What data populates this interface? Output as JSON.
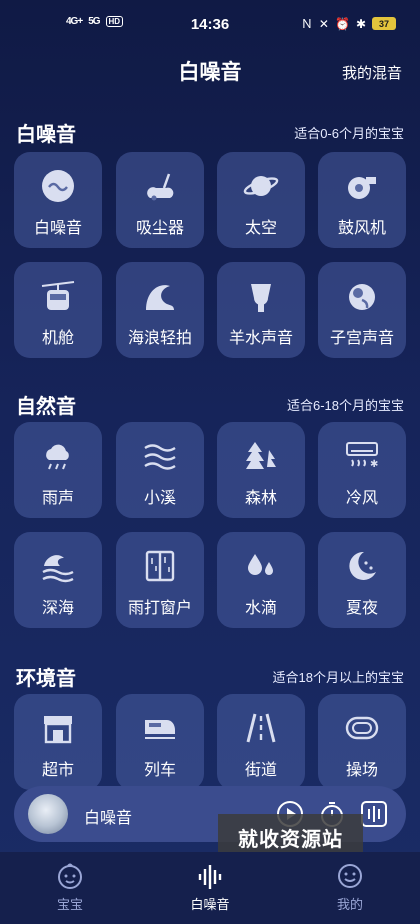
{
  "status": {
    "network": [
      "4G+",
      "5G"
    ],
    "hd": "HD",
    "time": "14:36",
    "battery": "37"
  },
  "header": {
    "title": "白噪音",
    "mymix": "我的混音"
  },
  "sections": [
    {
      "title": "白噪音",
      "subtitle": "适合0-6个月的宝宝",
      "items": [
        {
          "label": "白噪音",
          "icon": "wave-icon"
        },
        {
          "label": "吸尘器",
          "icon": "vacuum-icon"
        },
        {
          "label": "太空",
          "icon": "planet-icon"
        },
        {
          "label": "鼓风机",
          "icon": "blower-icon"
        },
        {
          "label": "机舱",
          "icon": "cable-car-icon"
        },
        {
          "label": "海浪轻拍",
          "icon": "ocean-wave-icon"
        },
        {
          "label": "羊水声音",
          "icon": "womb-icon"
        },
        {
          "label": "子宫声音",
          "icon": "fetus-icon"
        }
      ]
    },
    {
      "title": "自然音",
      "subtitle": "适合6-18个月的宝宝",
      "items": [
        {
          "label": "雨声",
          "icon": "rain-icon"
        },
        {
          "label": "小溪",
          "icon": "stream-icon"
        },
        {
          "label": "森林",
          "icon": "forest-icon"
        },
        {
          "label": "冷风",
          "icon": "air-conditioner-icon"
        },
        {
          "label": "深海",
          "icon": "deep-sea-icon"
        },
        {
          "label": "雨打窗户",
          "icon": "window-icon"
        },
        {
          "label": "水滴",
          "icon": "water-drop-icon"
        },
        {
          "label": "夏夜",
          "icon": "moon-icon"
        }
      ]
    },
    {
      "title": "环境音",
      "subtitle": "适合18个月以上的宝宝",
      "items": [
        {
          "label": "超市",
          "icon": "store-icon"
        },
        {
          "label": "列车",
          "icon": "train-icon"
        },
        {
          "label": "街道",
          "icon": "road-icon"
        },
        {
          "label": "操场",
          "icon": "track-icon"
        }
      ]
    }
  ],
  "player": {
    "name": "白噪音"
  },
  "watermark": "就收资源站",
  "nav": [
    {
      "label": "宝宝",
      "icon": "baby-icon",
      "active": false
    },
    {
      "label": "白噪音",
      "icon": "sound-bars-icon",
      "active": true
    },
    {
      "label": "我的",
      "icon": "smile-icon",
      "active": false
    }
  ],
  "colors": {
    "background": "#16245a",
    "tile": "#485ca0",
    "player": "#3b4c8e",
    "text": "#ffffff",
    "nav": "#15204d"
  }
}
